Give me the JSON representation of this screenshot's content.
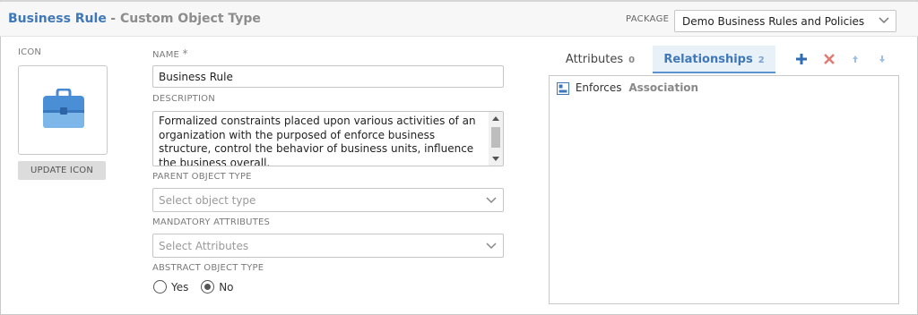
{
  "header": {
    "title": "Business Rule",
    "subtitle": "- Custom Object Type",
    "package_label": "PACKAGE",
    "package_value": "Demo Business Rules and Policies"
  },
  "icon_section": {
    "label": "ICON",
    "icon": "briefcase-icon",
    "update_button": "UPDATE ICON"
  },
  "form": {
    "name_label": "NAME",
    "required_mark": "*",
    "name_value": "Business Rule",
    "description_label": "DESCRIPTION",
    "description_value": "Formalized constraints placed upon various activities of an organization with the purposed of enforce business structure, control the behavior of business units, influence the business overall.",
    "parent_label": "PARENT OBJECT TYPE",
    "parent_placeholder": "Select object type",
    "mandatory_label": "MANDATORY ATTRIBUTES",
    "mandatory_placeholder": "Select Attributes",
    "abstract_label": "ABSTRACT OBJECT TYPE",
    "abstract_options": [
      {
        "label": "Yes",
        "selected": false
      },
      {
        "label": "No",
        "selected": true
      }
    ]
  },
  "tabs": [
    {
      "label": "Attributes",
      "count": "0",
      "active": false
    },
    {
      "label": "Relationships",
      "count": "2",
      "active": true
    }
  ],
  "toolbar": {
    "add": "plus-icon",
    "remove": "delete-icon",
    "move_up": "arrow-up-icon",
    "move_down": "arrow-down-icon"
  },
  "relationships": [
    {
      "name": "Enforces",
      "kind": "Association",
      "icon": "relationship-icon"
    }
  ],
  "colors": {
    "accent": "#3f78b9",
    "add": "#2f6db3",
    "remove": "#e07a72",
    "arrows": "#9fc0e2"
  }
}
